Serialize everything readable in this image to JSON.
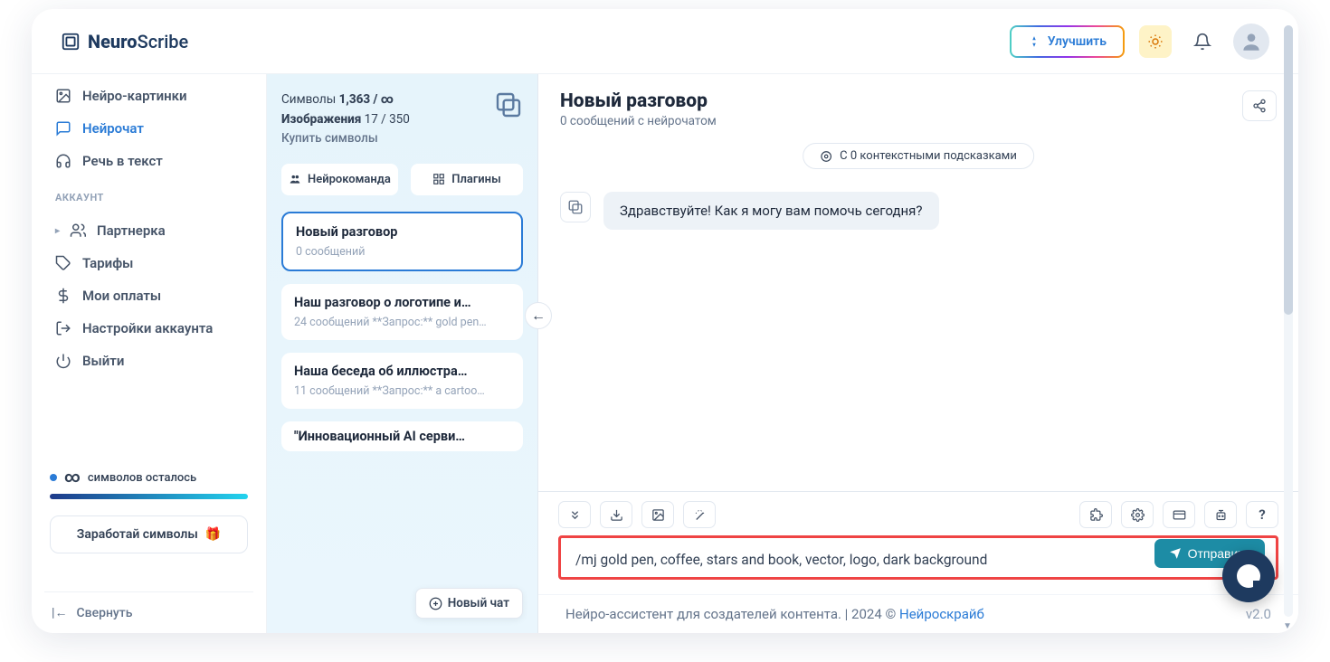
{
  "brand": {
    "bold": "Neuro",
    "light": "Scribe"
  },
  "top": {
    "upgrade": "Улучшить"
  },
  "sidebar": {
    "nav": [
      {
        "label": "Нейро-картинки",
        "icon": "image"
      },
      {
        "label": "Нейрочат",
        "icon": "chat",
        "active": true
      },
      {
        "label": "Речь в текст",
        "icon": "headphones"
      }
    ],
    "account_header": "АККАУНТ",
    "account": [
      {
        "label": "Партнерка",
        "icon": "users",
        "caret": true
      },
      {
        "label": "Тарифы",
        "icon": "tag"
      },
      {
        "label": "Мои оплаты",
        "icon": "dollar"
      },
      {
        "label": "Настройки аккаунта",
        "icon": "logout"
      },
      {
        "label": "Выйти",
        "icon": "power"
      }
    ],
    "usage": {
      "text": "символов осталось"
    },
    "earn": "Заработай символы",
    "collapse": "Свернуть"
  },
  "convpanel": {
    "symbols_label": "Символы",
    "symbols_value": "1,363 / ∞",
    "images_label": "Изображения",
    "images_value": "17 / 350",
    "buy": "Купить символы",
    "tab_team": "Нейрокоманда",
    "tab_plugins": "Плагины",
    "items": [
      {
        "title": "Новый разговор",
        "sub": "0 сообщений",
        "active": true
      },
      {
        "title": "Наш разговор о логотипе и…",
        "sub": "24 сообщений  **Запрос:** gold pen…"
      },
      {
        "title": "Наша беседа об иллюстра…",
        "sub": "11 сообщений  **Запрос:** a cartoo…"
      },
      {
        "title": "\"Инновационный AI серви…",
        "sub": ""
      }
    ],
    "newchat": "Новый чат"
  },
  "chat": {
    "title": "Новый разговор",
    "subtitle": "0 сообщений с нейрочатом",
    "context": "С 0 контекстными подсказками",
    "greeting": "Здравствуйте! Как я могу вам помочь сегодня?"
  },
  "composer": {
    "value": "/mj gold pen, coffee, stars and book, vector, logo, dark background",
    "send": "Отправить"
  },
  "footer": {
    "text": "Нейро-ассистент для создателей контента.  | 2024 ©",
    "link": "Нейроскрайб",
    "version": "v2.0"
  }
}
